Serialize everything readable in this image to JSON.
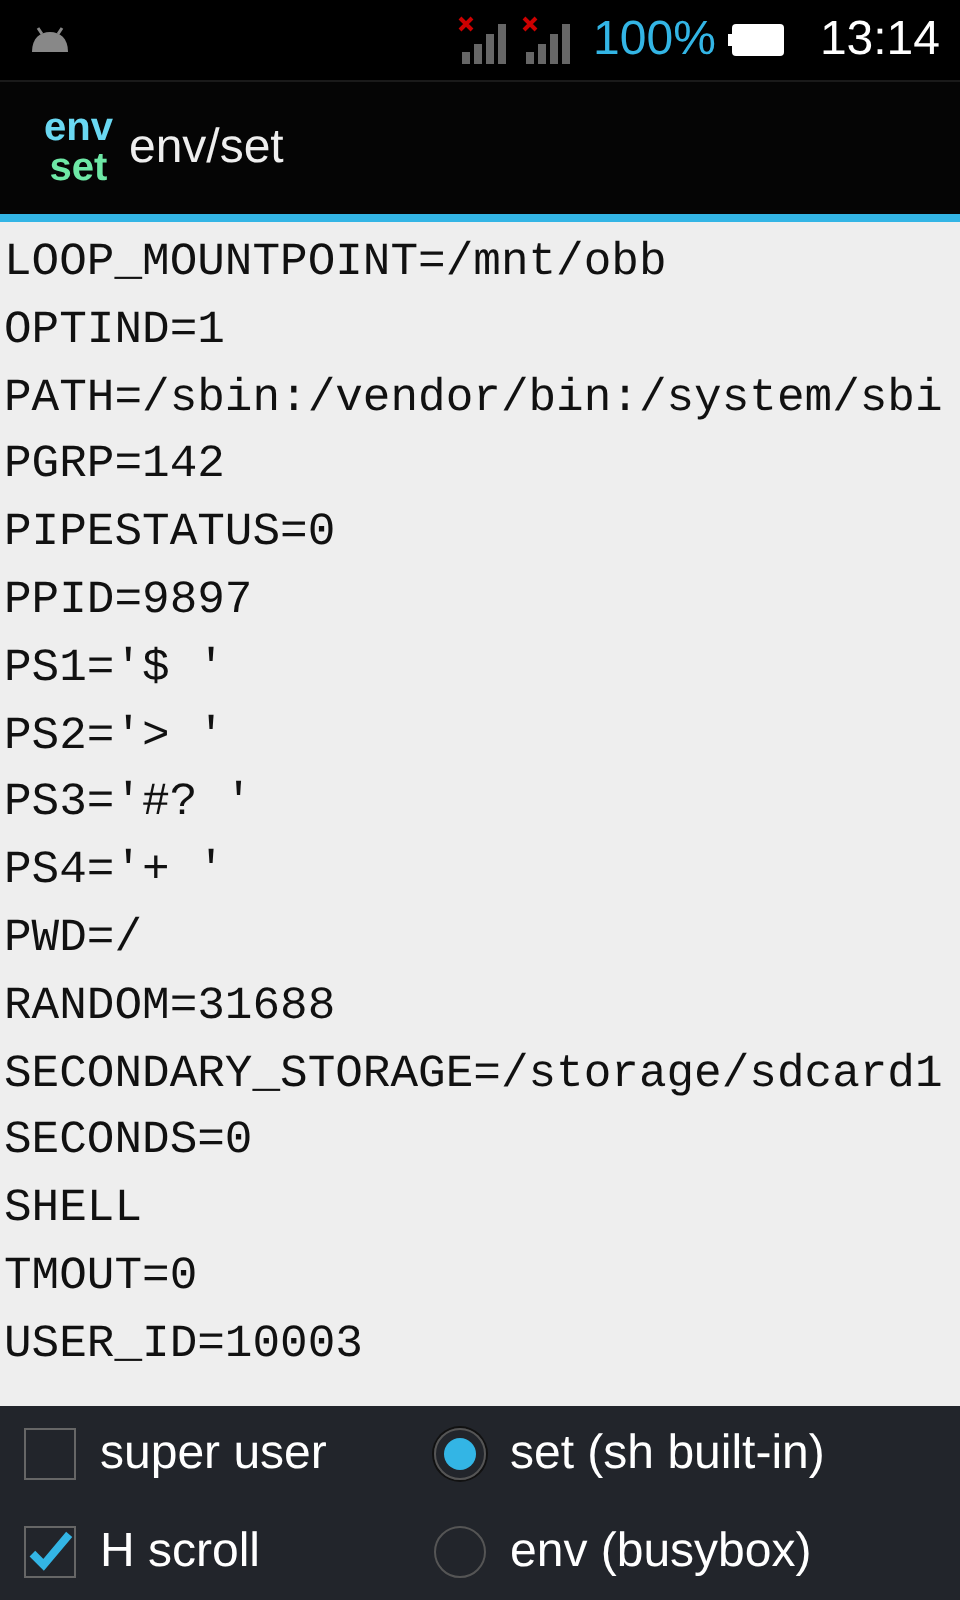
{
  "status_bar": {
    "signals": [
      {
        "no_service": true
      },
      {
        "no_service": true
      }
    ],
    "battery": "100%",
    "time": "13:14"
  },
  "action_bar": {
    "logo_top": "env",
    "logo_bottom": "set",
    "title": "env/set"
  },
  "lines": [
    "LOOP_MOUNTPOINT=/mnt/obb",
    "OPTIND=1",
    "PATH=/sbin:/vendor/bin:/system/sbi",
    "PGRP=142",
    "PIPESTATUS=0",
    "PPID=9897",
    "PS1='$ '",
    "PS2='> '",
    "PS3='#? '",
    "PS4='+ '",
    "PWD=/",
    "RANDOM=31688",
    "SECONDARY_STORAGE=/storage/sdcard1",
    "SECONDS=0",
    "SHELL",
    "TMOUT=0",
    "USER_ID=10003"
  ],
  "checkboxes": [
    {
      "label": "super user",
      "checked": false
    },
    {
      "label": "H scroll",
      "checked": true
    }
  ],
  "radios": [
    {
      "label": "set (sh built-in)",
      "selected": true
    },
    {
      "label": "env (busybox)",
      "selected": false
    }
  ]
}
